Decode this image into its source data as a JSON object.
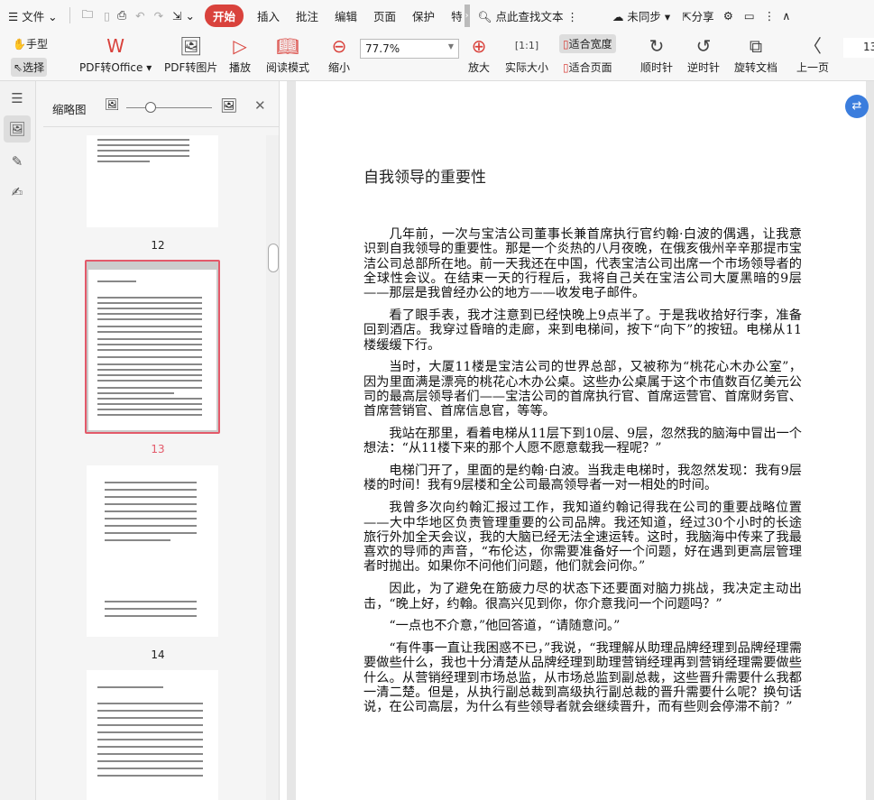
{
  "menubar": {
    "file": "文件",
    "tabs": [
      "开始",
      "插入",
      "批注",
      "编辑",
      "页面",
      "保护",
      "特"
    ],
    "search": "点此查找文本",
    "sync": "未同步",
    "share": "分享"
  },
  "toolbar": {
    "hand": "手型",
    "select": "选择",
    "pdf_to_office": "PDF转Office",
    "pdf_to_image": "PDF转图片",
    "play": "播放",
    "read_mode": "阅读模式",
    "zoom_out": "缩小",
    "zoom_value": "77.7%",
    "zoom_in": "放大",
    "actual_size": "实际大小",
    "fit_width": "适合宽度",
    "fit_page": "适合页面",
    "clockwise": "顺时针",
    "counterclockwise": "逆时针",
    "rotate_doc": "旋转文档",
    "prev_page": "上一页",
    "page_num": "13"
  },
  "thumbnails": {
    "title": "缩略图",
    "pages": [
      "12",
      "13",
      "14"
    ],
    "selected": "13"
  },
  "document": {
    "title": "自我领导的重要性",
    "paragraphs": [
      "几年前，一次与宝洁公司董事长兼首席执行官约翰·白波的偶遇，让我意识到自我领导的重要性。那是一个炎热的八月夜晚，在俄亥俄州辛辛那提市宝洁公司总部所在地。前一天我还在中国，代表宝洁公司出席一个市场领导者的全球性会议。在结束一天的行程后，我将自己关在宝洁公司大厦黑暗的9层——那层是我曾经办公的地方——收发电子邮件。",
      "看了眼手表，我才注意到已经快晚上9点半了。于是我收拾好行李，准备回到酒店。我穿过昏暗的走廊，来到电梯间，按下“向下”的按钮。电梯从11楼缓缓下行。",
      "当时，大厦11楼是宝洁公司的世界总部，又被称为“桃花心木办公室”，因为里面满是漂亮的桃花心木办公桌。这些办公桌属于这个市值数百亿美元公司的最高层领导者们——宝洁公司的首席执行官、首席运营官、首席财务官、首席营销官、首席信息官，等等。",
      "我站在那里，看着电梯从11层下到10层、9层，忽然我的脑海中冒出一个想法：“从11楼下来的那个人愿不愿意载我一程呢？”",
      "电梯门开了，里面的是约翰·白波。当我走电梯时，我忽然发现：我有9层楼的时间！我有9层楼和全公司最高领导者一对一相处的时间。",
      "我曾多次向约翰汇报过工作，我知道约翰记得我在公司的重要战略位置——大中华地区负责管理重要的公司品牌。我还知道，经过30个小时的长途旅行外加全天会议，我的大脑已经无法全速运转。这时，我脑海中传来了我最喜欢的导师的声音，“布伦达，你需要准备好一个问题，好在遇到更高层管理者时抛出。如果你不问他们问题，他们就会问你。”",
      "因此，为了避免在筋疲力尽的状态下还要面对脑力挑战，我决定主动出击，“晚上好，约翰。很高兴见到你，你介意我问一个问题吗？”",
      "“一点也不介意，”他回答道，“请随意问。”",
      "“有件事一直让我困惑不已，”我说，“我理解从助理品牌经理到品牌经理需要做些什么，我也十分清楚从品牌经理到助理营销经理再到营销经理需要做些什么。从营销经理到市场总监，从市场总监到副总裁，这些晋升需要什么我都一清二楚。但是，从执行副总裁到高级执行副总裁的晋升需要什么呢？换句话说，在公司高层，为什么有些领导者就会继续晋升，而有些则会停滞不前？”"
    ]
  },
  "colors": {
    "accent": "#d9423c",
    "float_btn": "#3b7ddd"
  }
}
